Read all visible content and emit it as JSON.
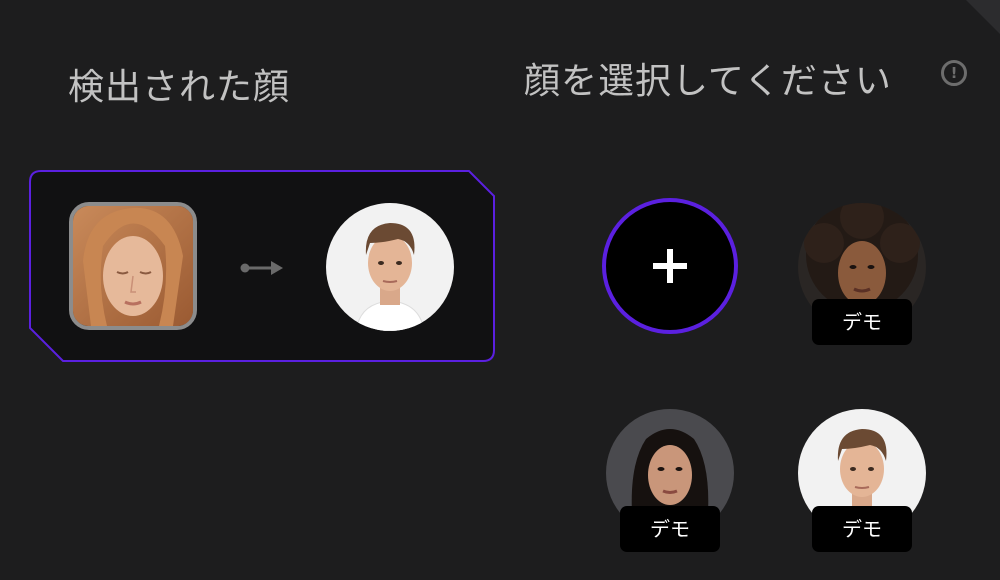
{
  "detected": {
    "title": "検出された顔",
    "source_face_icon": "woman-closed-eyes-photo",
    "arrow_icon": "arrow-right-icon",
    "target_face_icon": "young-man-photo"
  },
  "select": {
    "title": "顔を選択してください",
    "info_icon": "info-icon",
    "info_glyph": "!",
    "add_icon": "plus-icon"
  },
  "demos": [
    {
      "label": "デモ",
      "icon": "woman-curly-hair-photo"
    },
    {
      "label": "デモ",
      "icon": "woman-long-dark-hair-photo"
    },
    {
      "label": "デモ",
      "icon": "young-man-photo"
    }
  ],
  "colors": {
    "background": "#1d1d1e",
    "accent": "#5b20e0",
    "card": "#111112"
  }
}
